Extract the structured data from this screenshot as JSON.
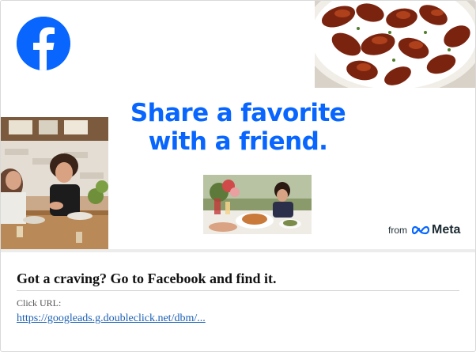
{
  "ad_creative": {
    "brand_logo": "facebook-logo-icon",
    "headline_line1": "Share a favorite",
    "headline_line2": "with a friend.",
    "byline_from": "from",
    "byline_brand": "Meta",
    "byline_icon": "meta-infinity-icon",
    "brand_color": "#0866ff",
    "images": [
      "chicken-wings-photo",
      "friends-cafe-photo",
      "outdoor-dinner-photo"
    ]
  },
  "ad_details": {
    "title": "Got a craving? Go to Facebook and find it.",
    "click_url_label": "Click URL:",
    "click_url": "https://googleads.g.doubleclick.net/dbm/..."
  }
}
